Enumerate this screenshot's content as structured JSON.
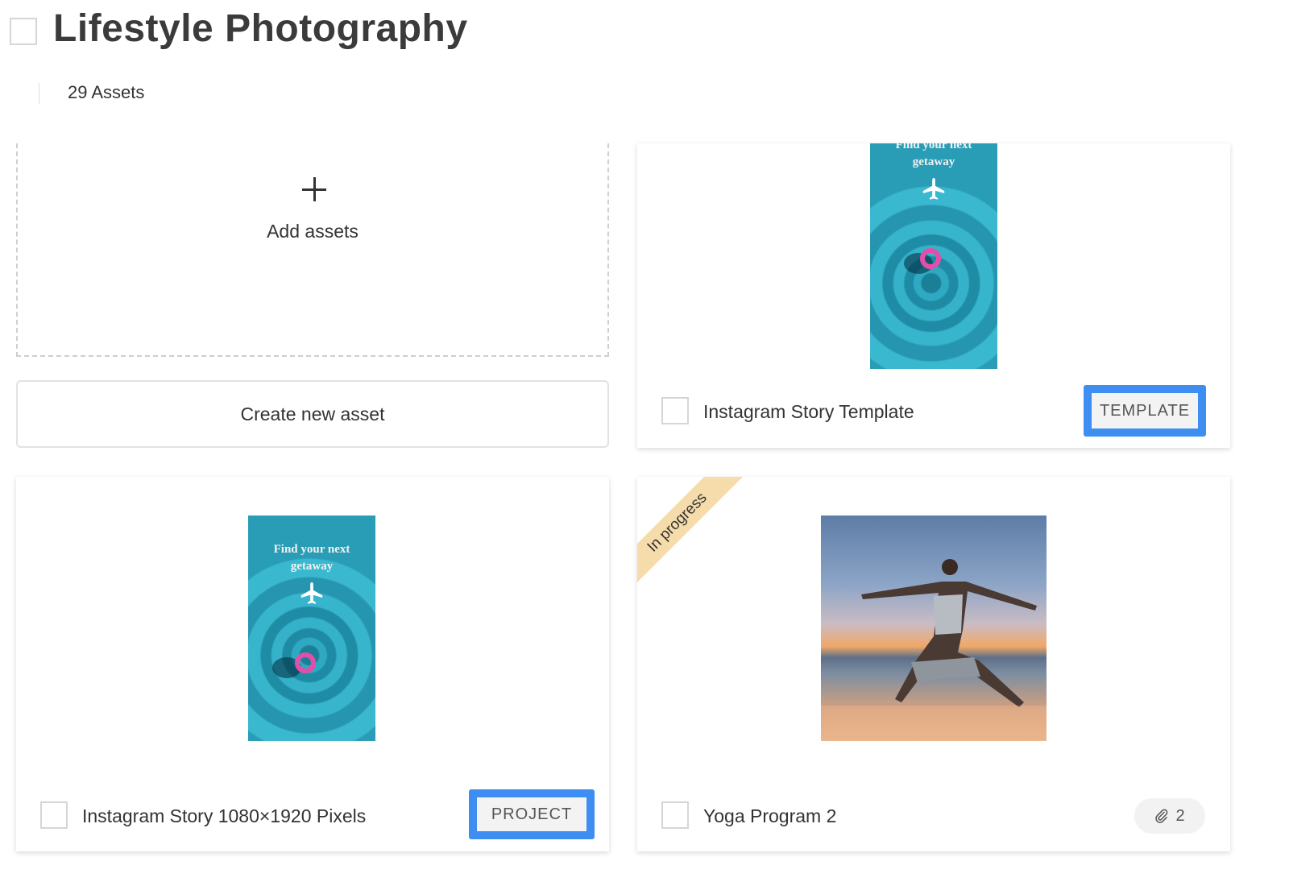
{
  "header": {
    "title": "Lifestyle Photography",
    "asset_count": "29 Assets"
  },
  "add_assets": {
    "label": "Add assets",
    "icon": "plus-icon"
  },
  "create_button": {
    "label": "Create new asset"
  },
  "cards": [
    {
      "name": "Instagram Story Template",
      "tag": "TEMPLATE",
      "thumbnail": {
        "line1": "Find your next",
        "line2": "getaway",
        "icon": "plane-icon"
      }
    },
    {
      "name": "Instagram Story 1080×1920 Pixels",
      "tag": "PROJECT",
      "thumbnail": {
        "line1": "Find your next",
        "line2": "getaway",
        "icon": "plane-icon"
      }
    },
    {
      "name": "Yoga Program 2",
      "ribbon": "In progress",
      "attachments": {
        "icon": "paperclip-icon",
        "count": "2"
      }
    }
  ],
  "colors": {
    "highlight": "#3d8ef0",
    "ribbon": "#f6dcaa",
    "water": "#2fa9c2"
  }
}
